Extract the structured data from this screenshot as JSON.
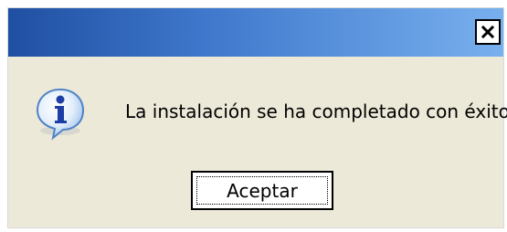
{
  "window": {
    "title": "",
    "close_icon": "close-icon"
  },
  "dialog": {
    "icon": "info-icon",
    "message": "La instalación se ha completado con éxito.",
    "ok_label": "Aceptar"
  },
  "colors": {
    "titlebar_start": "#1f4fa2",
    "titlebar_end": "#78b0ee",
    "dialog_bg": "#ece9d8"
  }
}
